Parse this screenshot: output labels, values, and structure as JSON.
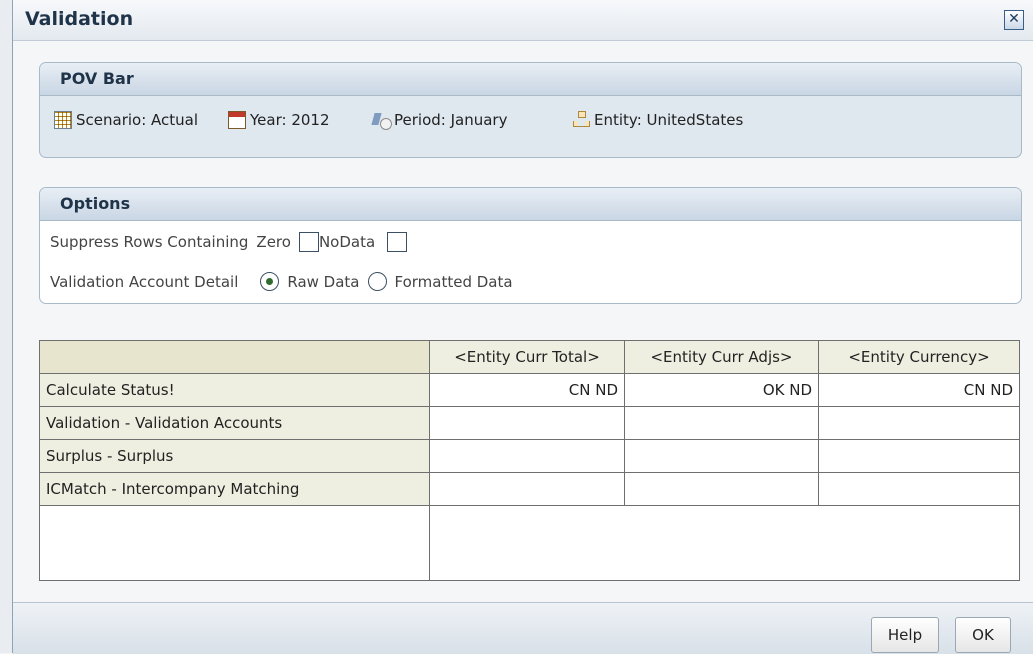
{
  "window": {
    "title": "Validation"
  },
  "pov": {
    "header": "POV Bar",
    "items": [
      {
        "icon": "scenario-grid-icon",
        "label": "Scenario: Actual"
      },
      {
        "icon": "calendar-icon",
        "label": "Year: 2012"
      },
      {
        "icon": "period-clock-icon",
        "label": "Period: January"
      },
      {
        "icon": "entity-hierarchy-icon",
        "label": "Entity: UnitedStates"
      }
    ]
  },
  "options": {
    "header": "Options",
    "suppress_label": "Suppress Rows Containing",
    "zero_label": "Zero",
    "zero_checked": false,
    "nodata_label": "NoData",
    "nodata_checked": false,
    "detail_label": "Validation Account Detail",
    "raw_label": "Raw Data",
    "formatted_label": "Formatted Data",
    "selected_detail": "Raw Data"
  },
  "grid": {
    "columns": [
      "<Entity Curr Total>",
      "<Entity Curr Adjs>",
      "<Entity Currency>"
    ],
    "rows": [
      {
        "label": "Calculate Status!",
        "values": [
          "CN ND",
          "OK ND",
          "CN ND"
        ]
      },
      {
        "label": "Validation - Validation Accounts",
        "values": [
          "",
          "",
          ""
        ]
      },
      {
        "label": "Surplus - Surplus",
        "values": [
          "",
          "",
          ""
        ]
      },
      {
        "label": "ICMatch - Intercompany Matching",
        "values": [
          "",
          "",
          ""
        ]
      }
    ]
  },
  "footer": {
    "help_label": "Help",
    "ok_label": "OK"
  }
}
